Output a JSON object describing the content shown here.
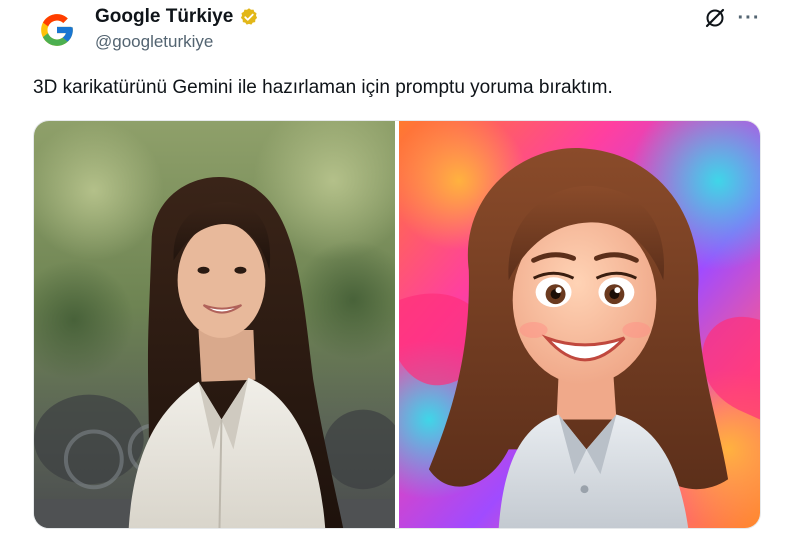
{
  "account": {
    "display_name": "Google Türkiye",
    "handle": "@googleturkiye",
    "avatar_icon": "google-g-logo-icon",
    "verified_icon": "gold-verified-badge-icon",
    "verified_color": "#e2b719"
  },
  "actions": {
    "grok_icon": "grok-icon",
    "more_icon": "more-options-icon",
    "more_label": "···"
  },
  "tweet": {
    "text": "3D karikatürünü Gemini ile hazırlaman için promptu yoruma bıraktım."
  },
  "media": {
    "images": [
      {
        "kind": "photo",
        "subject": "smiling-woman-outdoors"
      },
      {
        "kind": "cartoon",
        "subject": "3d-cartoon-woman-colorful-background"
      }
    ]
  },
  "colors": {
    "text_primary": "#0f1419",
    "text_secondary": "#536471"
  }
}
